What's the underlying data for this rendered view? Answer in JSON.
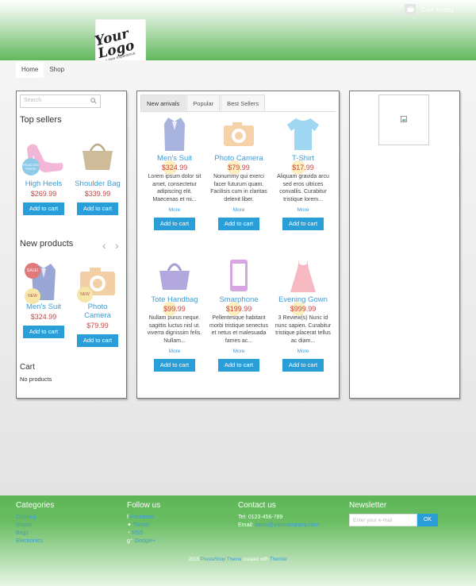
{
  "header": {
    "logo_text": "Your Logo",
    "logo_sub": "a new experience",
    "cart_label": "Cart: empty"
  },
  "nav": {
    "home": "Home",
    "shop": "Shop"
  },
  "sidebar": {
    "search_placeholder": "Search",
    "top_sellers_title": "Top sellers",
    "top_sellers": [
      {
        "name": "High Heels",
        "price": "$269.99",
        "badge": "REDUCED PRICE!",
        "button": "Add to cart"
      },
      {
        "name": "Shoulder Bag",
        "price": "$339.99",
        "button": "Add to cart"
      }
    ],
    "new_products_title": "New products",
    "new_products": [
      {
        "name": "Men's Suit",
        "price": "$324.99",
        "badge_sale": "SALE!",
        "badge_new": "NEW",
        "button": "Add to cart"
      },
      {
        "name": "Photo Camera",
        "price": "$79.99",
        "badge_new": "NEW",
        "button": "Add to cart"
      }
    ],
    "cart_title": "Cart",
    "cart_status": "No products"
  },
  "tabs": [
    "New arrivals",
    "Popular",
    "Best Sellers"
  ],
  "products": [
    {
      "name": "Men's Suit",
      "price": "$324.99",
      "desc": "Lorem ipsum dolor sit amet, consectetur adipiscing elit. Maecenas et mi...",
      "more": "More",
      "button": "Add to cart"
    },
    {
      "name": "Photo Camera",
      "price": "$79.99",
      "desc": "Nonummy qui exerci facer futurum quam. Facilisis cum in claritas delenit liber.",
      "more": "More",
      "button": "Add to cart"
    },
    {
      "name": "T-Shirt",
      "price": "$17.99",
      "desc": "Aliquam gravida arcu sed eros ultrices convallis. Curabitur tristique lorem...",
      "more": "More",
      "button": "Add to cart"
    },
    {
      "name": "Tote Handbag",
      "price": "$99.99",
      "desc": "Nullam purus neque. sagittis luctus nisl ut. viverra dignissim felis. Nullam...",
      "more": "More",
      "button": "Add to cart"
    },
    {
      "name": "Smarphone",
      "price": "$199.99",
      "desc": "Pellentesque habitant morbi tristique senectus et netus et malesuada fames ac...",
      "more": "More",
      "button": "Add to cart"
    },
    {
      "name": "Evening Gown",
      "price": "$999.99",
      "desc": "3 Review(s) Nunc id nunc sapien. Curabitur tristique placerat tellus ac diam...",
      "more": "More",
      "button": "Add to cart"
    }
  ],
  "footer": {
    "categories_title": "Categories",
    "categories": [
      "Clothing",
      "Shoes",
      "Bags",
      "Electronics"
    ],
    "follow_title": "Follow us",
    "follow": [
      "Facebook",
      "Twitter",
      "RSS",
      "Google+"
    ],
    "contact_title": "Contact us",
    "tel_label": "Tel:",
    "tel": "0123-456-789",
    "email_label": "Email:",
    "email": "sales@yourcompany.com",
    "newsletter_title": "Newsletter",
    "newsletter_placeholder": "Enter your e-mail",
    "newsletter_button": "OK",
    "credits_year": "2015",
    "credits_link1": "PrestaShop Theme",
    "credits_mid": "created with",
    "credits_link2": "Themler"
  },
  "colors": {
    "accent": "#2a9ed9",
    "link": "#3c9cd8",
    "price": "#cc4444",
    "green": "#5cb556"
  }
}
